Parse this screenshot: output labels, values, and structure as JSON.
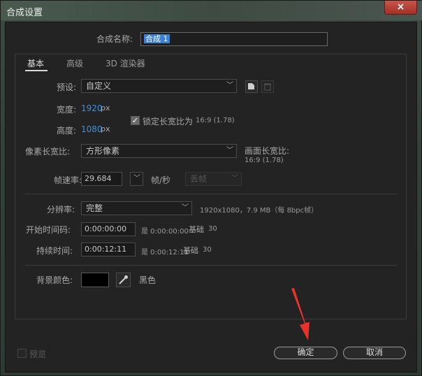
{
  "window": {
    "title": "合成设置",
    "close_icon": "×"
  },
  "comp_name": {
    "label": "合成名称:",
    "value": "合成 1"
  },
  "tabs": [
    {
      "label": "基本"
    },
    {
      "label": "高级"
    },
    {
      "label": "3D 渲染器"
    }
  ],
  "preset": {
    "label": "预设:",
    "value": "自定义"
  },
  "width": {
    "label": "宽度:",
    "value": "1920",
    "unit": "px"
  },
  "height": {
    "label": "高度:",
    "value": "1080",
    "unit": "px"
  },
  "lock_aspect": {
    "label": "锁定长宽比为",
    "ratio": "16:9 (1.78)",
    "checked": true
  },
  "pixel_aspect": {
    "label": "像素长宽比:",
    "value": "方形像素"
  },
  "frame_aspect": {
    "label": "画面长宽比:",
    "value": "16:9 (1.78)"
  },
  "frame_rate": {
    "label": "帧速率:",
    "value": "29.684",
    "unit": "帧/秒",
    "drop_frame": "丢帧"
  },
  "resolution": {
    "label": "分辨率:",
    "value": "完整",
    "info": "1920x1080，7.9 MB（每 8bpc帧）"
  },
  "start_timecode": {
    "label": "开始时间码:",
    "value": "0:00:00:00",
    "is_text": "是 0:00:00:00",
    "base_label": "基础",
    "base_value": "30"
  },
  "duration": {
    "label": "持续时间:",
    "value": "0:00:12:11",
    "is_text": "是 0:00:12:11",
    "base_label": "基础",
    "base_value": "30"
  },
  "background": {
    "label": "背景颜色:",
    "color_name": "黑色",
    "color": "#000000"
  },
  "preview": {
    "label": "预览",
    "checked": false
  },
  "buttons": {
    "ok": "确定",
    "cancel": "取消"
  },
  "colors": {
    "accent_blue": "#3f8fdb",
    "arrow_red": "#e8332a"
  }
}
